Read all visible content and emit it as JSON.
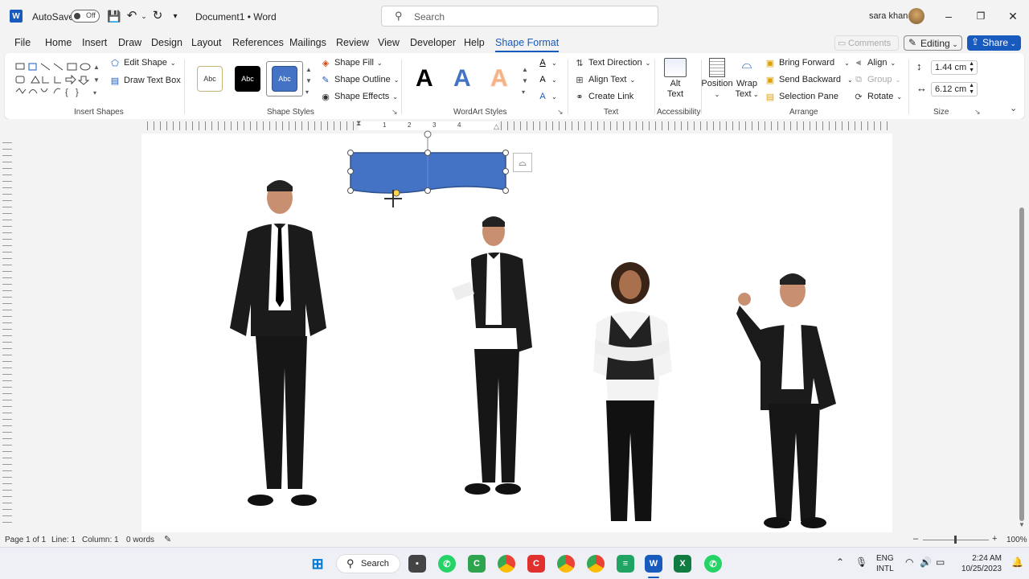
{
  "titlebar": {
    "app_logo": "W",
    "autosave_label": "AutoSave",
    "autosave_state": "Off",
    "title": "Document1 • Word",
    "search_placeholder": "Search",
    "user_name": "sara khan"
  },
  "tabs": [
    "File",
    "Home",
    "Insert",
    "Draw",
    "Design",
    "Layout",
    "References",
    "Mailings",
    "Review",
    "View",
    "Developer",
    "Help",
    "Shape Format"
  ],
  "top_right": {
    "comments": "Comments",
    "editing": "Editing",
    "share": "Share"
  },
  "ribbon": {
    "insert_shapes": {
      "label": "Insert Shapes",
      "edit_shape": "Edit Shape",
      "draw_text_box": "Draw Text Box"
    },
    "shape_styles": {
      "label": "Shape Styles",
      "swatches": [
        "Abc",
        "Abc",
        "Abc"
      ],
      "shape_fill": "Shape Fill",
      "shape_outline": "Shape Outline",
      "shape_effects": "Shape Effects"
    },
    "wordart_styles": {
      "label": "WordArt Styles",
      "letters": [
        "A",
        "A",
        "A"
      ]
    },
    "text": {
      "label": "Text",
      "text_direction": "Text Direction",
      "align_text": "Align Text",
      "create_link": "Create Link"
    },
    "accessibility": {
      "label": "Accessibility",
      "alt_text_1": "Alt",
      "alt_text_2": "Text"
    },
    "arrange": {
      "label": "Arrange",
      "position": "Position",
      "wrap_1": "Wrap",
      "wrap_2": "Text",
      "bring_forward": "Bring Forward",
      "send_backward": "Send Backward",
      "selection_pane": "Selection Pane",
      "align": "Align",
      "group": "Group",
      "rotate": "Rotate"
    },
    "size": {
      "label": "Size",
      "height": "1.44 cm",
      "width": "6.12 cm"
    }
  },
  "ruler_numbers": [
    "1",
    "2",
    "3",
    "4"
  ],
  "status": {
    "page": "Page 1 of 1",
    "line": "Line: 1",
    "column": "Column: 1",
    "words": "0 words",
    "zoom": "100%"
  },
  "taskbar": {
    "search": "Search",
    "lang_1": "ENG",
    "lang_2": "INTL",
    "time": "2:24 AM",
    "date": "10/25/2023"
  },
  "colors": {
    "accent": "#185abd",
    "shape_fill": "#4472c4",
    "shape_border": "#2f528f"
  }
}
